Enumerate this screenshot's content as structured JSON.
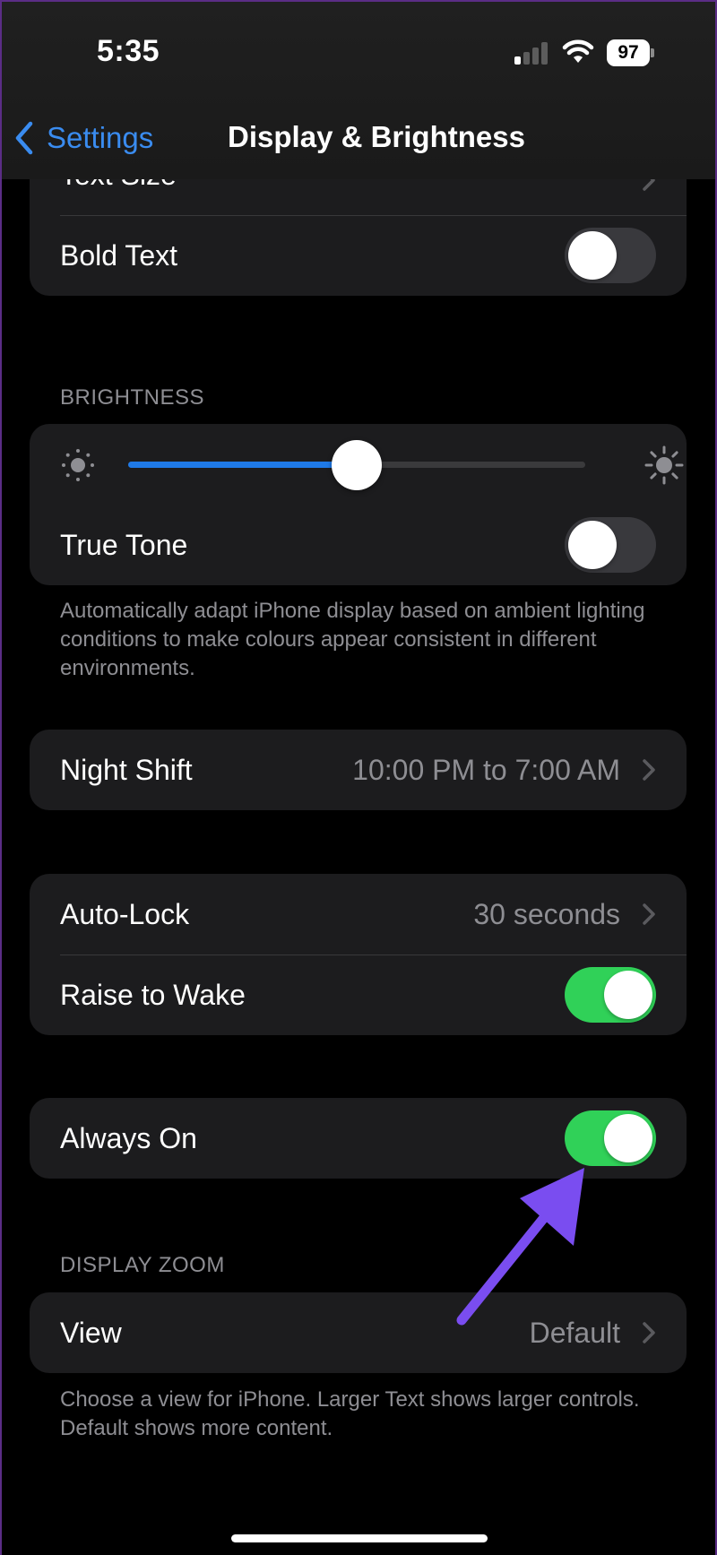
{
  "status": {
    "time": "5:35",
    "battery": "97",
    "signal_bars_active": 1,
    "signal_bars_total": 4
  },
  "nav": {
    "back_label": "Settings",
    "title": "Display & Brightness"
  },
  "text_group": {
    "text_size_label": "Text Size",
    "bold_text_label": "Bold Text",
    "bold_text_on": false
  },
  "brightness": {
    "header": "BRIGHTNESS",
    "level": 0.5,
    "true_tone_label": "True Tone",
    "true_tone_on": false,
    "footer": "Automatically adapt iPhone display based on ambient lighting conditions to make colours appear consistent in different environments."
  },
  "night_shift": {
    "label": "Night Shift",
    "value": "10:00 PM to 7:00 AM"
  },
  "lock_group": {
    "auto_lock_label": "Auto-Lock",
    "auto_lock_value": "30 seconds",
    "raise_to_wake_label": "Raise to Wake",
    "raise_to_wake_on": true
  },
  "always_on": {
    "label": "Always On",
    "on": true
  },
  "display_zoom": {
    "header": "DISPLAY ZOOM",
    "view_label": "View",
    "view_value": "Default",
    "footer": "Choose a view for iPhone. Larger Text shows larger controls. Default shows more content."
  },
  "colors": {
    "accent_blue": "#1f7ae8",
    "link_blue": "#3a8cf0",
    "toggle_on": "#30d158",
    "annotation_arrow": "#7a4df0"
  }
}
